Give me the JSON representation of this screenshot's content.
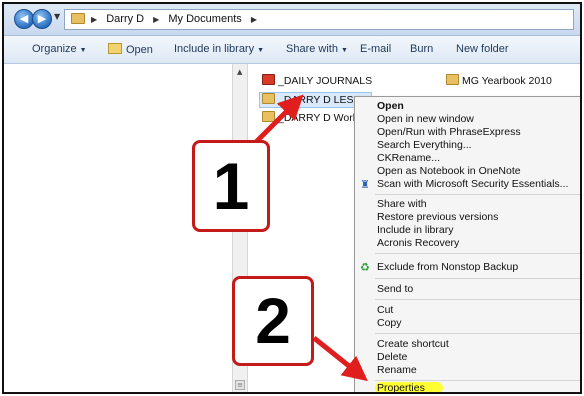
{
  "address": {
    "crumbs": [
      "Darry D",
      "My Documents"
    ]
  },
  "toolbar": {
    "organize": "Organize",
    "open": "Open",
    "include": "Include in library",
    "share": "Share with",
    "email": "E-mail",
    "burn": "Burn",
    "new_folder": "New folder"
  },
  "files": [
    {
      "name": "_DAILY JOURNALS",
      "icon": "red-folder-icon"
    },
    {
      "name": "_DARRY D LESSO",
      "icon": "folder-icon",
      "selected": true
    },
    {
      "name": "_DARRY D Works",
      "icon": "folder-icon"
    },
    {
      "name": "MG Yearbook 2010",
      "icon": "folder-icon"
    }
  ],
  "context_menu": {
    "items": [
      {
        "label": "Open",
        "bold": true
      },
      {
        "label": "Open in new window"
      },
      {
        "label": "Open/Run with PhraseExpress"
      },
      {
        "label": "Search Everything..."
      },
      {
        "label": "CKRename..."
      },
      {
        "label": "Open as Notebook in OneNote"
      },
      {
        "label": "Scan with Microsoft Security Essentials...",
        "icon": "security-essentials-icon"
      },
      {
        "label": "Share with"
      },
      {
        "label": "Restore previous versions"
      },
      {
        "label": "Include in library"
      },
      {
        "label": "Acronis Recovery"
      },
      {
        "label": "Exclude from Nonstop Backup",
        "icon": "nonstop-backup-icon"
      },
      {
        "label": "Send to"
      },
      {
        "label": "Cut"
      },
      {
        "label": "Copy"
      },
      {
        "label": "Create shortcut"
      },
      {
        "label": "Delete"
      },
      {
        "label": "Rename"
      },
      {
        "label": "Properties",
        "highlighted": true,
        "highlight_color": "#ffff33"
      }
    ]
  },
  "callouts": {
    "one": "1",
    "two": "2",
    "border_color": "#c41a1a"
  }
}
